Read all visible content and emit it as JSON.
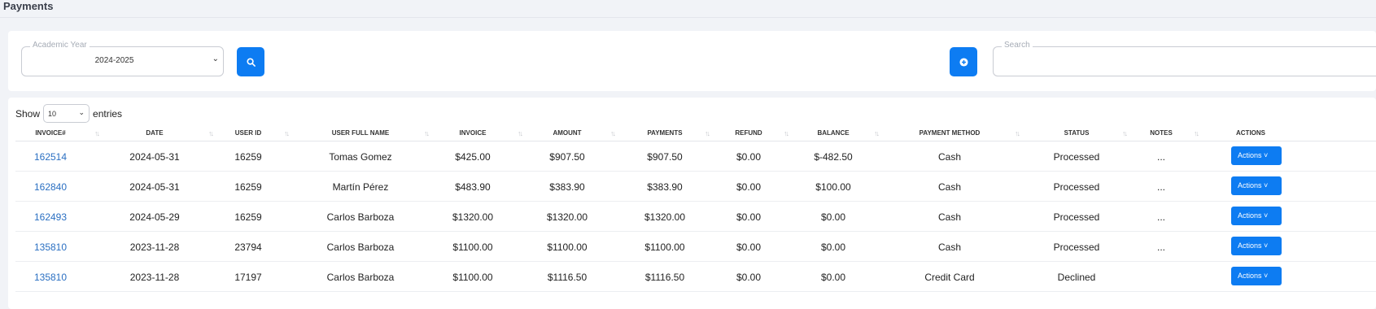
{
  "page": {
    "title": "Payments"
  },
  "filters": {
    "academic_year": {
      "legend": "Academic Year",
      "value": "2024-2025"
    },
    "search": {
      "legend": "Search",
      "value": ""
    },
    "search_icon": "search-icon",
    "add_icon": "plus-circle-icon",
    "accent_color": "#0d7cf2"
  },
  "table": {
    "show_label": "Show",
    "page_length": "10",
    "entries_label": "entries",
    "columns": [
      "INVOICE#",
      "DATE",
      "USER ID",
      "USER FULL NAME",
      "INVOICE",
      "AMOUNT",
      "PAYMENTS",
      "REFUND",
      "BALANCE",
      "PAYMENT METHOD",
      "STATUS",
      "NOTES",
      "ACTIONS"
    ],
    "action_label": "Actions",
    "rows": [
      {
        "invoice_no": "162514",
        "date": "2024-05-31",
        "user_id": "16259",
        "name": "Tomas Gomez",
        "invoice": "$425.00",
        "amount": "$907.50",
        "payments": "$907.50",
        "refund": "$0.00",
        "balance": "$-482.50",
        "method": "Cash",
        "status": "Processed",
        "notes": "..."
      },
      {
        "invoice_no": "162840",
        "date": "2024-05-31",
        "user_id": "16259",
        "name": "Martín Pérez",
        "invoice": "$483.90",
        "amount": "$383.90",
        "payments": "$383.90",
        "refund": "$0.00",
        "balance": "$100.00",
        "method": "Cash",
        "status": "Processed",
        "notes": "..."
      },
      {
        "invoice_no": "162493",
        "date": "2024-05-29",
        "user_id": "16259",
        "name": "Carlos Barboza",
        "invoice": "$1320.00",
        "amount": "$1320.00",
        "payments": "$1320.00",
        "refund": "$0.00",
        "balance": "$0.00",
        "method": "Cash",
        "status": "Processed",
        "notes": "..."
      },
      {
        "invoice_no": "135810",
        "date": "2023-11-28",
        "user_id": "23794",
        "name": "Carlos Barboza",
        "invoice": "$1100.00",
        "amount": "$1100.00",
        "payments": "$1100.00",
        "refund": "$0.00",
        "balance": "$0.00",
        "method": "Cash",
        "status": "Processed",
        "notes": "..."
      },
      {
        "invoice_no": "135810",
        "date": "2023-11-28",
        "user_id": "17197",
        "name": "Carlos Barboza",
        "invoice": "$1100.00",
        "amount": "$1116.50",
        "payments": "$1116.50",
        "refund": "$0.00",
        "balance": "$0.00",
        "method": "Credit Card",
        "status": "Declined",
        "notes": ""
      }
    ]
  }
}
